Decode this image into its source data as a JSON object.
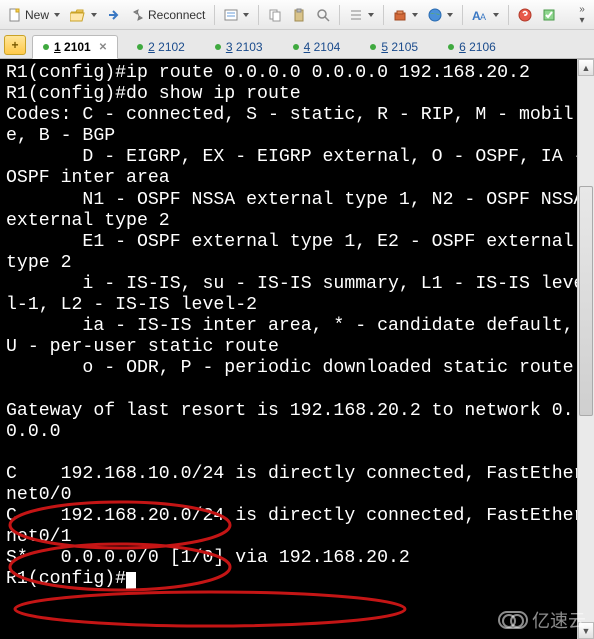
{
  "toolbar": {
    "new_label": "New",
    "reconnect_label": "Reconnect"
  },
  "tabs": {
    "items": [
      {
        "num": "1",
        "port": "2101",
        "active": true,
        "closable": true
      },
      {
        "num": "2",
        "port": "2102"
      },
      {
        "num": "3",
        "port": "2103"
      },
      {
        "num": "4",
        "port": "2104"
      },
      {
        "num": "5",
        "port": "2105"
      },
      {
        "num": "6",
        "port": "2106"
      }
    ]
  },
  "terminal": {
    "lines": [
      "R1(config)#ip route 0.0.0.0 0.0.0.0 192.168.20.2",
      "R1(config)#do show ip route",
      "Codes: C - connected, S - static, R - RIP, M - mobile, B - BGP",
      "       D - EIGRP, EX - EIGRP external, O - OSPF, IA - OSPF inter area ",
      "       N1 - OSPF NSSA external type 1, N2 - OSPF NSSA external type 2",
      "       E1 - OSPF external type 1, E2 - OSPF external type 2",
      "       i - IS-IS, su - IS-IS summary, L1 - IS-IS level-1, L2 - IS-IS level-2",
      "       ia - IS-IS inter area, * - candidate default, U - per-user static route",
      "       o - ODR, P - periodic downloaded static route",
      "",
      "Gateway of last resort is 192.168.20.2 to network 0.0.0.0",
      "",
      "C    192.168.10.0/24 is directly connected, FastEthernet0/0",
      "C    192.168.20.0/24 is directly connected, FastEthernet0/1",
      "S*   0.0.0.0/0 [1/0] via 192.168.20.2"
    ],
    "prompt": "R1(config)#"
  },
  "watermark": "亿速云"
}
